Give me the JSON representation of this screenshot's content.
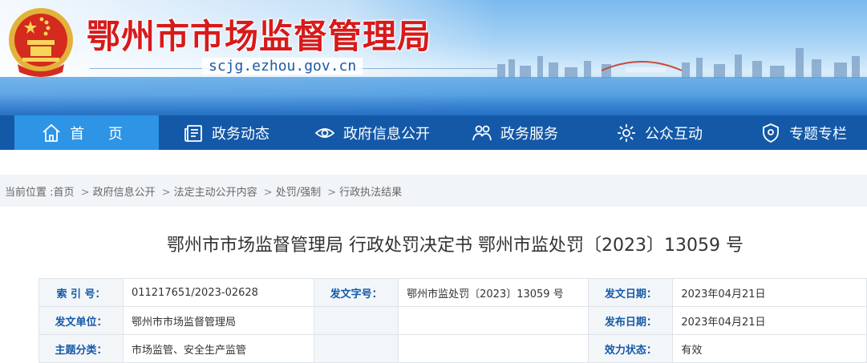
{
  "header": {
    "title": "鄂州市市场监督管理局",
    "domain": "scjg.ezhou.gov.cn"
  },
  "nav": {
    "items": [
      {
        "label": "首 页",
        "icon": "home-icon",
        "active": true
      },
      {
        "label": "政务动态",
        "icon": "news-icon"
      },
      {
        "label": "政府信息公开",
        "icon": "eye-icon"
      },
      {
        "label": "政务服务",
        "icon": "handshake-icon"
      },
      {
        "label": "公众互动",
        "icon": "gear-icon"
      },
      {
        "label": "专题专栏",
        "icon": "shield-icon"
      }
    ]
  },
  "breadcrumb": {
    "prefix": "当前位置 :",
    "items": [
      "首页",
      "政府信息公开",
      "法定主动公开内容",
      "处罚/强制",
      "行政执法结果"
    ],
    "separator": ">"
  },
  "document": {
    "title": "鄂州市市场监督管理局 行政处罚决定书 鄂州市监处罚〔2023〕13059 号"
  },
  "info_table": {
    "rows": [
      [
        {
          "key": "索 引 号：",
          "value": "011217651/2023-02628"
        },
        {
          "key": "发文字号：",
          "value": "鄂州市监处罚〔2023〕13059 号"
        },
        {
          "key": "发文日期：",
          "value": "2023年04月21日"
        }
      ],
      [
        {
          "key": "发文单位：",
          "value": "鄂州市市场监督管理局"
        },
        {
          "key": "",
          "value": ""
        },
        {
          "key": "发布日期：",
          "value": "2023年04月21日"
        }
      ],
      [
        {
          "key": "主题分类：",
          "value": "市场监管、安全生产监管"
        },
        {
          "key": "",
          "value": ""
        },
        {
          "key": "效力状态：",
          "value": "有效"
        }
      ]
    ]
  },
  "colors": {
    "nav_bg": "#1459a8",
    "nav_active": "#2d94e6",
    "title_red": "#d71a1b",
    "key_text": "#1459a8"
  }
}
